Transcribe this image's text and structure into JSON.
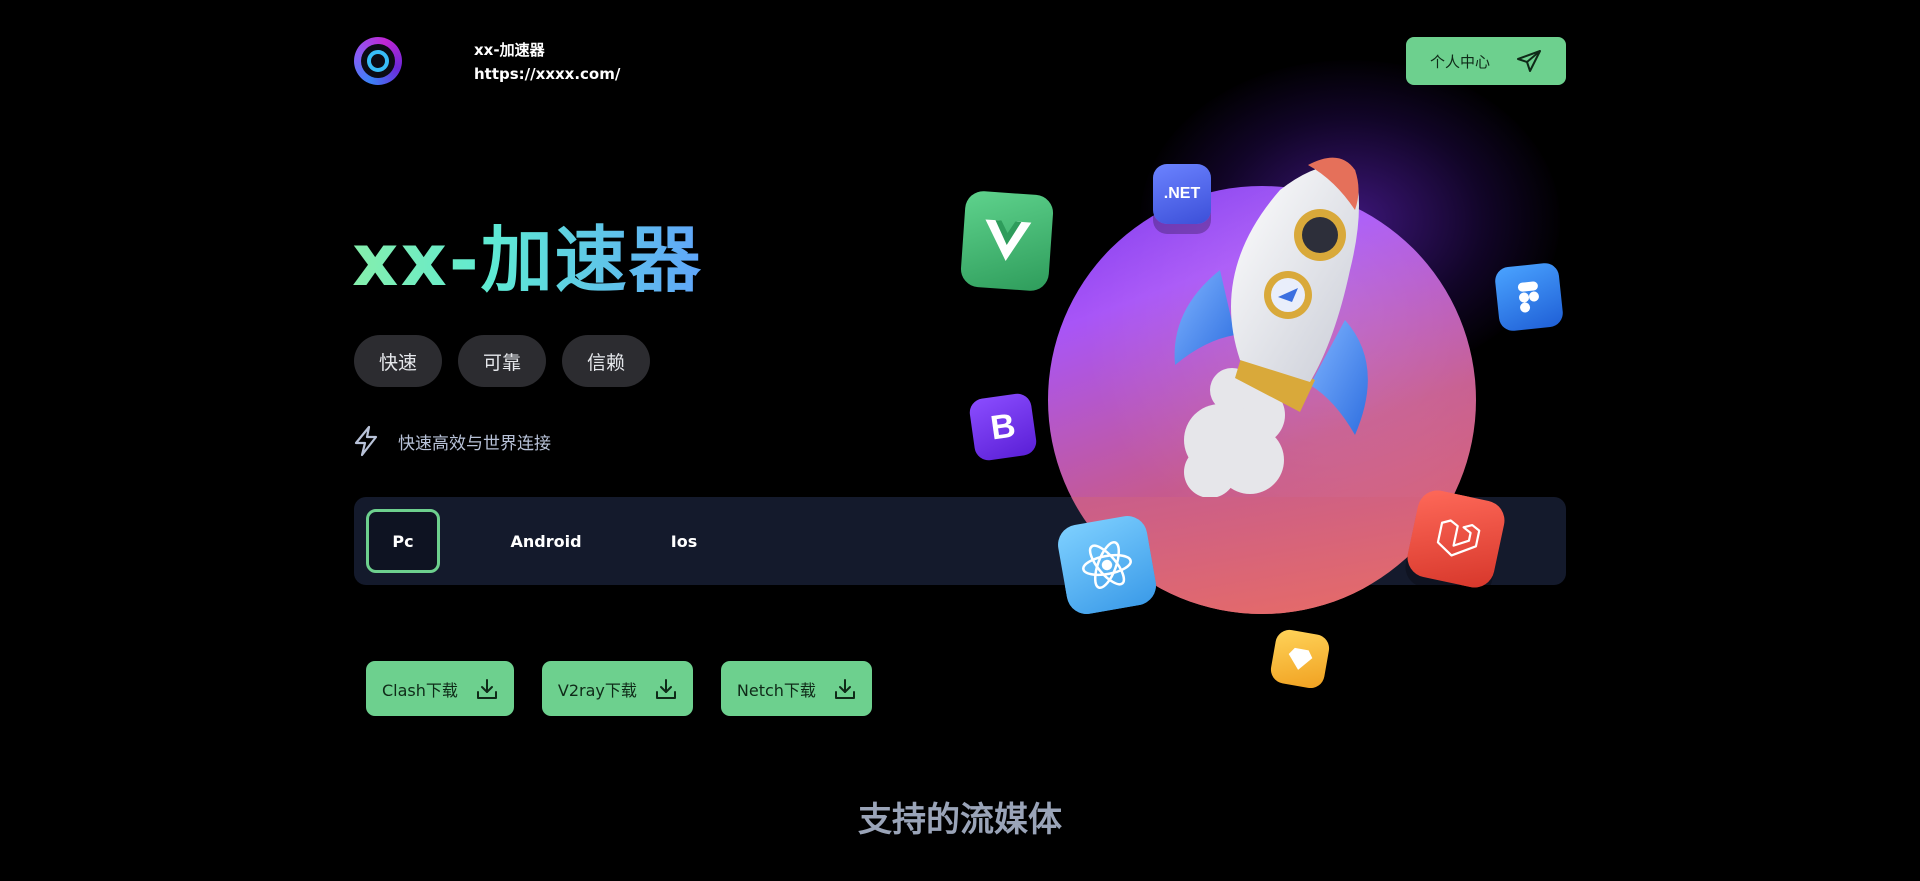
{
  "header": {
    "site_name": "xx-加速器",
    "site_url": "https://xxxx.com/",
    "user_center_label": "个人中心"
  },
  "hero": {
    "title": "xx-加速器",
    "tags": [
      "快速",
      "可靠",
      "信赖"
    ],
    "feature_text": "快速高效与世界连接"
  },
  "platform_tabs": [
    {
      "label": "Pc",
      "active": true
    },
    {
      "label": "Android",
      "active": false
    },
    {
      "label": "Ios",
      "active": false
    }
  ],
  "downloads": [
    {
      "label": "Clash下载"
    },
    {
      "label": "V2ray下载"
    },
    {
      "label": "Netch下载"
    }
  ],
  "section": {
    "title": "支持的流媒体"
  },
  "illustration": {
    "badges": [
      ".NET",
      "B"
    ]
  },
  "colors": {
    "accent": "#6dd08e",
    "background": "#000000",
    "tab_bar": "#141a2c",
    "tag_bg": "#2c2c30"
  }
}
